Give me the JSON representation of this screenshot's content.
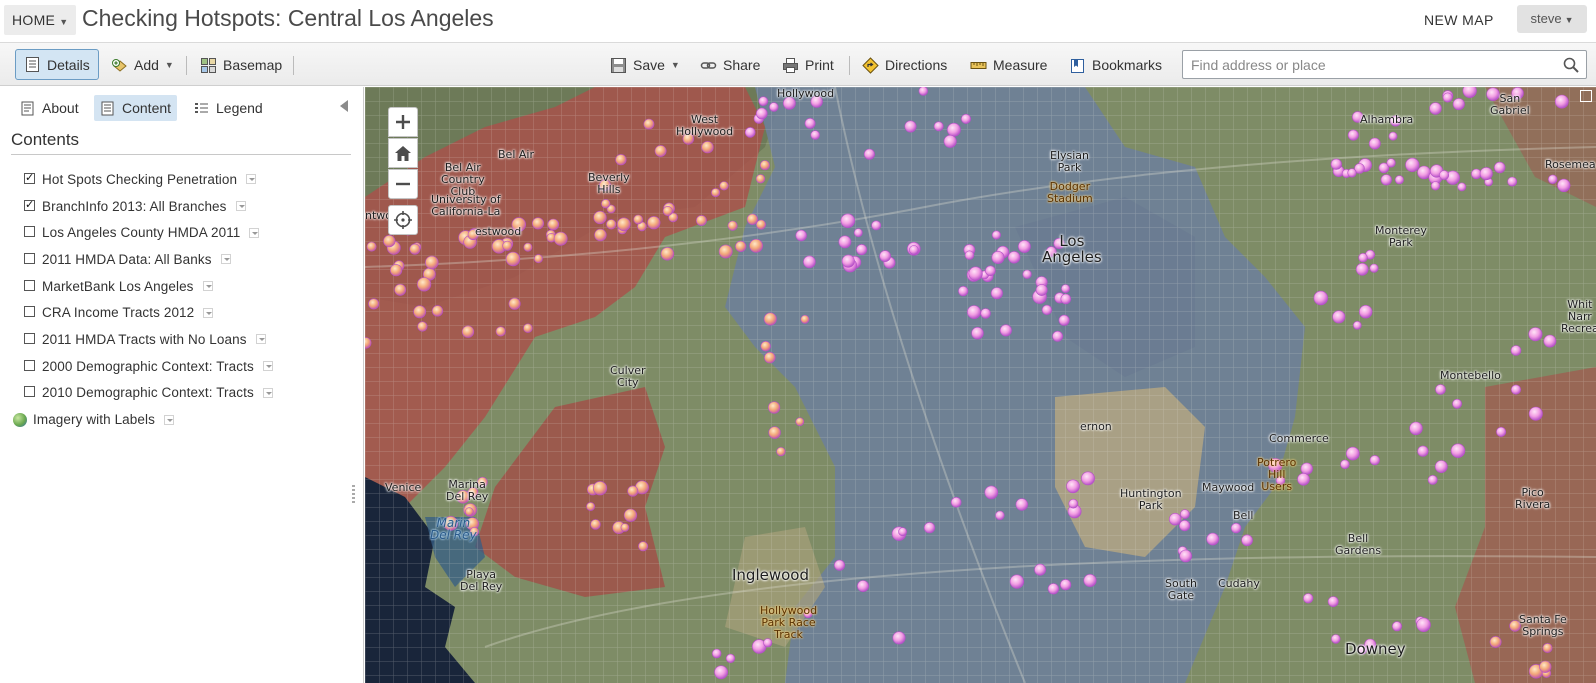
{
  "header": {
    "home_label": "HOME",
    "title": "Checking Hotspots: Central Los Angeles",
    "new_map_label": "NEW MAP",
    "user_label": "steve"
  },
  "toolbar": {
    "details_label": "Details",
    "add_label": "Add",
    "basemap_label": "Basemap",
    "save_label": "Save",
    "share_label": "Share",
    "print_label": "Print",
    "directions_label": "Directions",
    "measure_label": "Measure",
    "bookmarks_label": "Bookmarks",
    "search_placeholder": "Find address or place"
  },
  "sidebar": {
    "tabs": {
      "about": "About",
      "content": "Content",
      "legend": "Legend"
    },
    "active_tab": "Content",
    "heading": "Contents",
    "layers": [
      {
        "label": "Hot Spots Checking Penetration",
        "checked": true
      },
      {
        "label": "BranchInfo 2013: All Branches",
        "checked": true
      },
      {
        "label": "Los Angeles County HMDA 2011",
        "checked": false
      },
      {
        "label": "2011 HMDA Data: All Banks",
        "checked": false
      },
      {
        "label": "MarketBank Los Angeles",
        "checked": false
      },
      {
        "label": "CRA Income Tracts 2012",
        "checked": false
      },
      {
        "label": "2011 HMDA Tracts with No Loans",
        "checked": false
      },
      {
        "label": "2000 Demographic Context: Tracts",
        "checked": false
      },
      {
        "label": "2010 Demographic Context: Tracts",
        "checked": false
      }
    ],
    "basemap_layer": "Imagery with Labels"
  },
  "map": {
    "labels": {
      "hollywood": "Hollywood",
      "west_hollywood": "West\nHollywood",
      "bel_air": "Bel Air",
      "bel_air_club": "Bel Air\nCountry\nClub",
      "ucla": "University of\nCalifornia-La",
      "beverly_hills": "Beverly\nHills",
      "westwood": "estwood",
      "entwood": "ntwood",
      "elysian_park": "Elysian\nPark",
      "dodger_stadium": "Dodger\nStadium",
      "los_angeles": "Los\nAngeles",
      "alhambra": "Alhambra",
      "san_gabriel": "San\nGabriel",
      "rosemead": "Rosemea",
      "monterey_park": "Monterey\nPark",
      "culver_city": "Culver\nCity",
      "montebello": "Montebello",
      "vernon": "ernon",
      "commerce": "Commerce",
      "potrero": "Potrero\nHill\nUsers",
      "venice": "Venice",
      "marina_del_rey": "Marina\nDel Rey",
      "marina_water": "Marin\nDel Rey",
      "huntington_park": "Huntington\nPark",
      "maywood": "Maywood",
      "bell": "Bell",
      "bell_gardens": "Bell\nGardens",
      "pico_rivera": "Pico\nRivera",
      "inglewood": "Inglewood",
      "hollywood_park": "Hollywood\nPark Race\nTrack",
      "playa_del_rey": "Playa\nDel Rey",
      "south_gate": "South\nGate",
      "cudahy": "Cudahy",
      "santa_fe_springs": "Santa Fe\nSprings",
      "downey": "Downey",
      "whittier": "Whit\nNarr\nRecrea"
    },
    "colors": {
      "hot": "#b0524c",
      "warm": "#a69a72",
      "neutral": "#8d9e76",
      "cool": "#6d7f9b",
      "branch_fill": "#f4b0e6",
      "branch_ring": "#b651c8"
    }
  }
}
